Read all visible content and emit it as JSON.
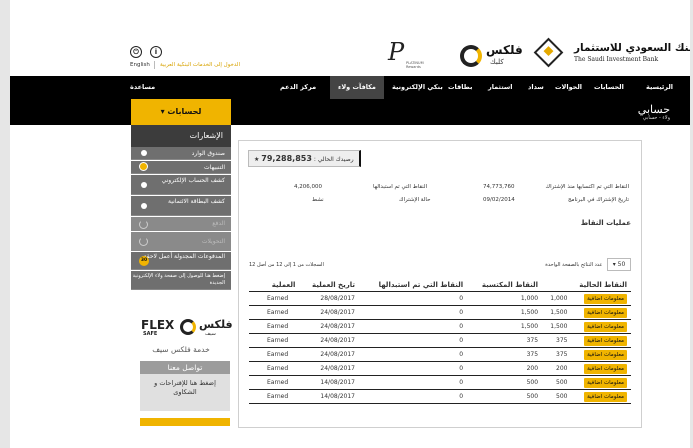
{
  "header": {
    "bank_name_ar": "البنك السعودي للاستثمار",
    "bank_name_en": "The Saudi Investment Bank",
    "flex_ar": "فلكس",
    "flex_sub": "كلبك",
    "platinum_label": "PLATINUM Rewards",
    "power_label": "English",
    "info_label": "العربية",
    "lang_en": "English",
    "lang_ar": "العربية",
    "personal_banking": "الدخول إلى الخدمات البنكية"
  },
  "nav": {
    "items": [
      "الرئيسية",
      "الحسابات",
      "الحوالات",
      "سداد",
      "استثمار",
      "بطاقات",
      "بنكي الإلكترونية",
      "مكافآت ولاء",
      "مركز الدعم"
    ],
    "active_index": 7,
    "help": "مساعدة"
  },
  "title": {
    "text": "حسابي",
    "breadcrumb": "ولاء - حسابي"
  },
  "sidebar": {
    "dropdown_label": "لحسابات",
    "header": "الإشعارات",
    "items": [
      {
        "label": "صندوق الوارد"
      },
      {
        "label": "التنبيهات"
      },
      {
        "label": "كشف الحساب الإلكتروني"
      },
      {
        "label": "كشف البطاقة الائتمانية"
      },
      {
        "label": "الدفع"
      },
      {
        "label": "التحويلات"
      },
      {
        "label": "المدفوعات المجدولة أعمل لاحقة",
        "badge": "30"
      },
      {
        "label": "إضغط هنا للوصول إلى صفحة ولاء الإلكترونية الجديدة"
      }
    ],
    "flex_safe_en": "FLEX",
    "flex_safe_en2": "SAFE",
    "flex_safe_ar": "فلكس",
    "flex_safe_ar2": "سيف",
    "flex_safe_caption": "خدمة فلكس سيف",
    "contact_title": "تواصل معنا",
    "contact_body": "إضغط هنا للإقتراحات و الشكاوى"
  },
  "balance": {
    "label": "رصيدك الحالي :",
    "value": "79,288,853"
  },
  "account_info": {
    "earned_label": "النقاط التي تم اكتسابها منذ الإشتراك",
    "earned_value": "74,773,760",
    "redeemed_label": "النقاط التي تم استبدالها",
    "redeemed_value": "4,206,000",
    "join_label": "تاريخ الإشتراك في البرنامج",
    "join_value": "09/02/2014",
    "status_label": "حالة الإشتراك",
    "status_value": "نشط"
  },
  "transactions": {
    "section_title": "عمليات النقاط",
    "per_page_label": "عدد النتائج بالصفحة الواحدة",
    "per_page_value": "50",
    "records_text": "السجلات من 1 إلى 12 من أصل 12",
    "columns": [
      "النقاط الحالية",
      "النقاط المكتسبة",
      "النقاط التي تم استبدالها",
      "تاريخ العملية",
      "العملية"
    ],
    "more_label": "معلومات اضافية",
    "rows": [
      {
        "current": "1,000",
        "earned": "1,000",
        "redeemed": "0",
        "date": "28/08/2017",
        "type": "Earned"
      },
      {
        "current": "1,500",
        "earned": "1,500",
        "redeemed": "0",
        "date": "24/08/2017",
        "type": "Earned"
      },
      {
        "current": "1,500",
        "earned": "1,500",
        "redeemed": "0",
        "date": "24/08/2017",
        "type": "Earned"
      },
      {
        "current": "375",
        "earned": "375",
        "redeemed": "0",
        "date": "24/08/2017",
        "type": "Earned"
      },
      {
        "current": "375",
        "earned": "375",
        "redeemed": "0",
        "date": "24/08/2017",
        "type": "Earned"
      },
      {
        "current": "200",
        "earned": "200",
        "redeemed": "0",
        "date": "24/08/2017",
        "type": "Earned"
      },
      {
        "current": "500",
        "earned": "500",
        "redeemed": "0",
        "date": "14/08/2017",
        "type": "Earned"
      },
      {
        "current": "500",
        "earned": "500",
        "redeemed": "0",
        "date": "14/08/2017",
        "type": "Earned"
      }
    ]
  }
}
